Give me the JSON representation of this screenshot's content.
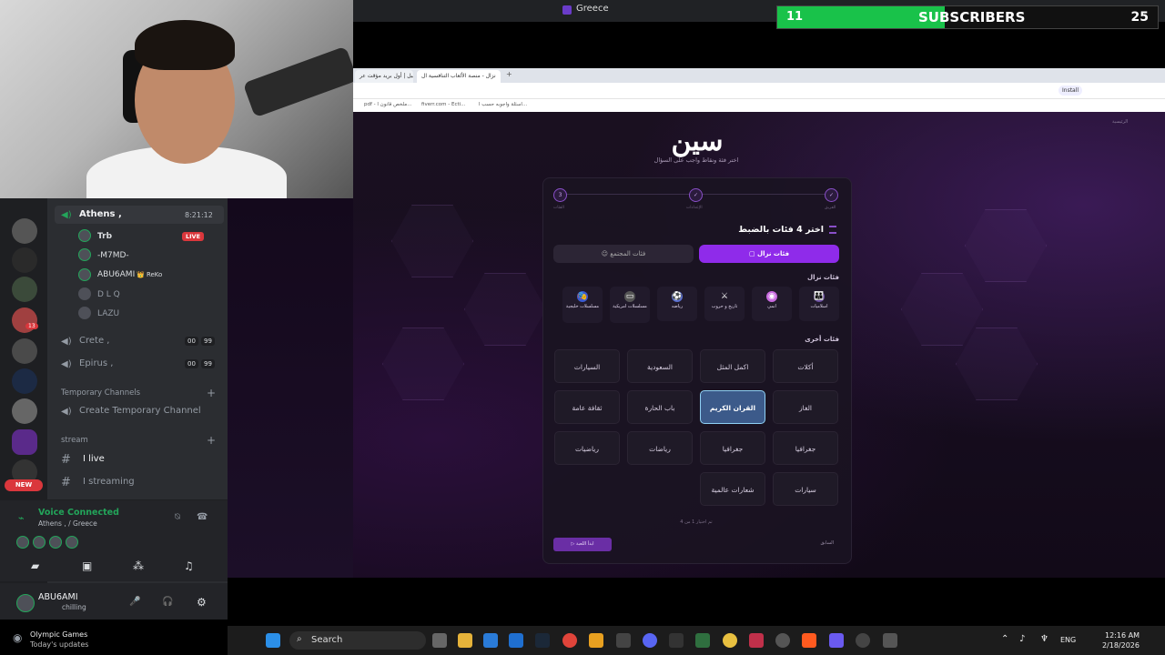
{
  "obs": {
    "window_title": "Greece",
    "subscribers": {
      "count": "11",
      "label": "SUBSCRIBERS",
      "goal": "25",
      "progress": 0.44
    }
  },
  "browser": {
    "tabs": [
      "تهيبل | أول بريد مؤقت عر",
      "نزال - منصة الألعاب التنافسية ال"
    ],
    "install_label": "Install",
    "bookmarks": [
      "pdf - ملخص قانون ا...",
      "fiverr.com - Ecti...",
      "اسئلة واجوبه حسب ا..."
    ]
  },
  "game": {
    "logo": "سين",
    "subtitle": "اختر فئة ونقاط واجب على السؤال",
    "breadcrumb": "الرئيسية",
    "steps": [
      {
        "num": "1",
        "label": "الفريق"
      },
      {
        "num": "2",
        "label": "الإعدادات"
      },
      {
        "num": "3",
        "label": "الفئات"
      }
    ],
    "pick_header": "اختر 4 فئات بالضبط",
    "segments": {
      "nazal": "فئات نزال",
      "community": "فئات المجتمع"
    },
    "nazal_section": "فئات نزال",
    "nazal_categories": [
      {
        "label": "اسلاميات",
        "icon": "👪"
      },
      {
        "label": "انمي",
        "icon": "◉"
      },
      {
        "label": "تاريخ و حروب",
        "icon": "⚔"
      },
      {
        "label": "رياضه",
        "icon": "⚽"
      },
      {
        "label": "مسلسلات امريكية",
        "icon": "▭"
      },
      {
        "label": "مسلسلات خليجية",
        "icon": "🎭"
      }
    ],
    "other_section": "فئات أخرى",
    "other_categories": [
      [
        "أكلات",
        "اكمل المثل",
        "السعودية",
        "السيارات"
      ],
      [
        "الغاز",
        "القران الكريم",
        "باب الحارة",
        "ثقافة عامة"
      ],
      [
        "جغرافيا",
        "جغرافيا",
        "رياضات",
        "رياضيات"
      ],
      [
        "سيارات",
        "شعارات عالمية"
      ]
    ],
    "selected": "القران الكريم",
    "counter": "تم اختيار 1 من 4",
    "start_label": "ابدأ اللعبة",
    "prev_label": "السابق"
  },
  "discord": {
    "channels": [
      {
        "name": "Athens ,",
        "time": "8:21:12"
      },
      {
        "name": "Crete ,",
        "c1": "00",
        "c2": "99"
      },
      {
        "name": "Epirus ,",
        "c1": "00",
        "c2": "99"
      }
    ],
    "users": [
      {
        "name": "Trb",
        "live": "LIVE"
      },
      {
        "name": "-M7MD-"
      },
      {
        "name": "ABU6AMI",
        "tag": "👑 ReKo"
      },
      {
        "name": "D L Q"
      },
      {
        "name": "LAZU"
      }
    ],
    "temp_category": "Temporary Channels",
    "create_temp": "Create Temporary Channel",
    "stream_category": "stream",
    "text_channels": [
      "I live",
      "I streaming"
    ],
    "voice_status": "Voice Connected",
    "voice_location": "Athens , / Greece",
    "username": "ABU6AMI",
    "user_status": "chilling",
    "new_badge": "NEW",
    "notif_count": "13"
  },
  "taskbar": {
    "widget_title": "Olympic Games",
    "widget_sub": "Today's updates",
    "search": "Search",
    "lang": "ENG",
    "time": "12:16 AM",
    "date": "2/18/2026"
  },
  "colors": {
    "accent": "#8f2bea",
    "discord_green": "#23a55a",
    "subs_green": "#19c24a"
  }
}
